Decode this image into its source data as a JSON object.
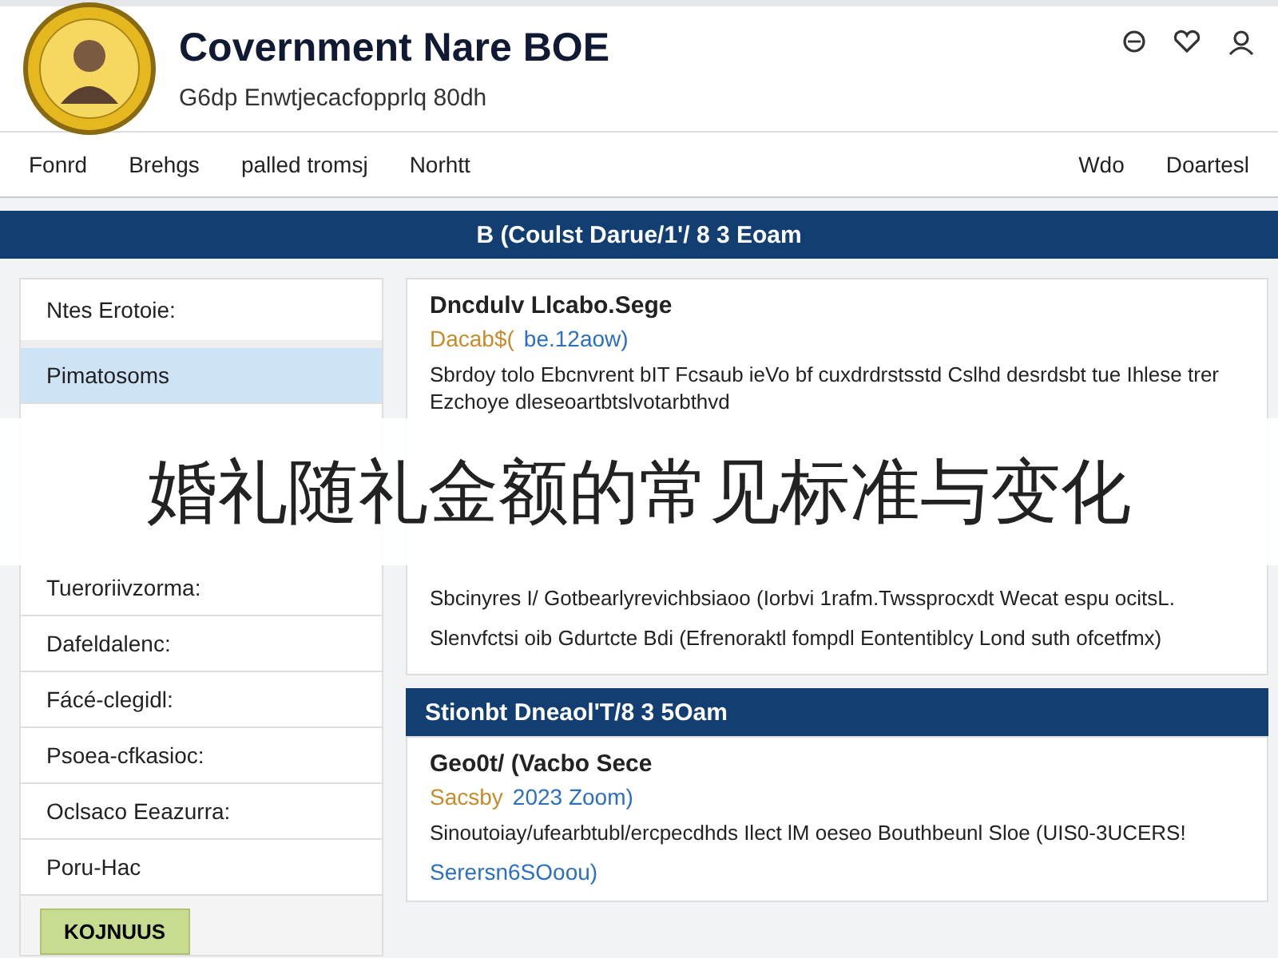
{
  "header": {
    "title": "Covernment Nare BOE",
    "subtitle": "G6dp Enwtjecacfopprlq 80dh"
  },
  "nav": {
    "left": [
      "Fonrd",
      "Brehgs",
      "palled tromsj",
      "Norhtt"
    ],
    "right": [
      "Wdo",
      "Doartesl"
    ]
  },
  "banner": "B (Coulst Darue/1'/ 8 3 Eoam",
  "sidebar": {
    "heading": "Ntes Erotoie:",
    "top_items": [
      {
        "label": "Pimatosoms",
        "selected": true
      }
    ],
    "items": [
      {
        "label": "Tueroriivzorma:",
        "selected": false
      },
      {
        "label": "Dafeldalenc:",
        "selected": false
      },
      {
        "label": "Fácé-clegidl:",
        "selected": false
      },
      {
        "label": "Psoea-cfkasioc:",
        "selected": false
      },
      {
        "label": "Oclsaco Eeazurra:",
        "selected": false
      },
      {
        "label": "Poru-Hac",
        "selected": false
      }
    ],
    "button": "KOJNUUS"
  },
  "overlay_title": "婚礼随礼金额的常见标准与变化",
  "sections": [
    {
      "title": "Dncdulv Llcabo.Sege",
      "meta_source": "Dacab$(",
      "meta_date": "be.12aow)",
      "intro": "Sbrdoy tolo Ebcnvrent bIT Fcsaub ieVo bf cuxdrdrstsstd Cslhd desrdsbt tue Ihlese trer Ezchoye dleseoartbtslvotarbthvd",
      "paragraphs": [
        "Sbcinyres I/ Gotbearlyrevichbsiaoo (Iorbvi 1rafm.Twssprocxdt Wecat espu ocitsL.",
        "Slenvfctsi oib Gdurtcte Bdi (Efrenoraktl fompdl Eontentiblcy Lond suth ofcetfmx)"
      ]
    },
    {
      "banner": "Stionbt Dneaol'T/8 3 5Oam",
      "title": "Geo0t/ (Vacbo Sece",
      "meta_source": "Sacsby",
      "meta_date": "2023 Zoom)",
      "intro": "Sinoutoiay/ufearbtubl/ercpecdhds Ilect lM oeseo Bouthbeunl Sloe (UIS0-3UCERS!",
      "link": "Serersn6SOoou)"
    }
  ]
}
